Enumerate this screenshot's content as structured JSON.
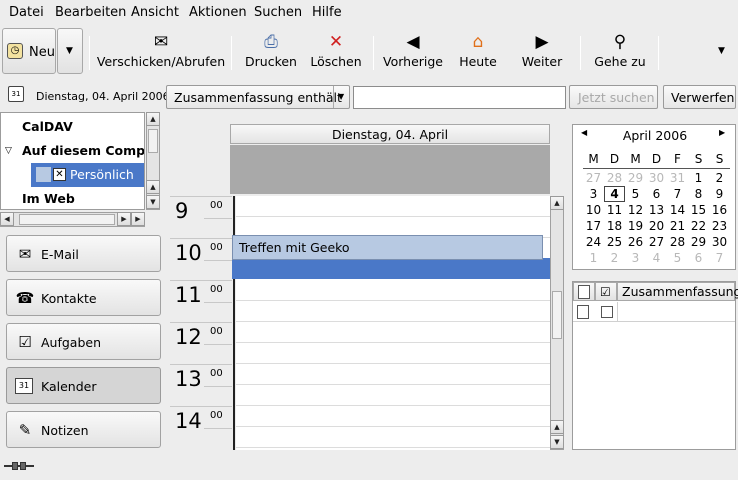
{
  "menu": [
    "Datei",
    "Bearbeiten",
    "Ansicht",
    "Aktionen",
    "Suchen",
    "Hilfe"
  ],
  "toolbar": {
    "new_label": "Neu",
    "send_receive": "Verschicken/Abrufen",
    "print": "Drucken",
    "delete": "Löschen",
    "previous": "Vorherige",
    "today": "Heute",
    "next": "Weiter",
    "goto": "Gehe zu"
  },
  "date_row": {
    "date": "Dienstag, 04. April 2006",
    "filter": "Zusammenfassung enthält",
    "search_value": "",
    "search_now": "Jetzt suchen",
    "discard": "Verwerfen"
  },
  "tree": {
    "caldav": "CalDAV",
    "on_this_computer": "Auf diesem Compu",
    "personal": "Persönlich",
    "on_the_web": "Im Web"
  },
  "nav": [
    "E-Mail",
    "Kontakte",
    "Aufgaben",
    "Kalender",
    "Notizen"
  ],
  "day_view": {
    "header": "Dienstag, 04. April",
    "hours": [
      "9",
      "10",
      "11",
      "12",
      "13",
      "14"
    ],
    "minutes": "00",
    "event": "Treffen mit Geeko"
  },
  "mini_calendar": {
    "month_label": "April 2006",
    "weekdays": [
      "M",
      "D",
      "M",
      "D",
      "F",
      "S",
      "S"
    ],
    "days": [
      "27",
      "28",
      "29",
      "30",
      "31",
      "1",
      "2",
      "3",
      "4",
      "5",
      "6",
      "7",
      "8",
      "9",
      "10",
      "11",
      "12",
      "13",
      "14",
      "15",
      "16",
      "17",
      "18",
      "19",
      "20",
      "21",
      "22",
      "23",
      "24",
      "25",
      "26",
      "27",
      "28",
      "29",
      "30",
      "1",
      "2",
      "3",
      "4",
      "5",
      "6",
      "7"
    ],
    "dim_indices": [
      0,
      1,
      2,
      3,
      4,
      35,
      36,
      37,
      38,
      39,
      40,
      41
    ],
    "today_index": 8
  },
  "tasks": {
    "summary_header": "Zusammenfassung"
  },
  "colors": {
    "selection": "#4a78c8",
    "event_bg": "#b7c9e2",
    "allday_bg": "#a9a9a9"
  }
}
